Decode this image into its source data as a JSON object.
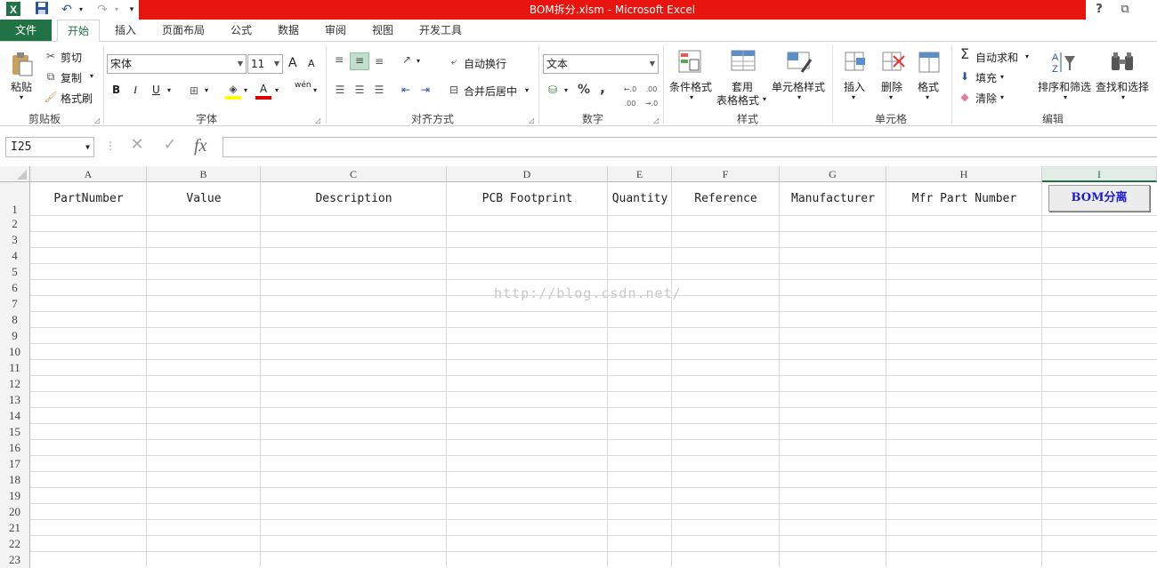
{
  "window": {
    "title": "BOM拆分.xlsm - Microsoft Excel",
    "help": "?",
    "restore": "⧉"
  },
  "tabs": [
    "文件",
    "开始",
    "插入",
    "页面布局",
    "公式",
    "数据",
    "审阅",
    "视图",
    "开发工具"
  ],
  "ribbon": {
    "clipboard": {
      "paste": "粘贴",
      "cut": "剪切",
      "copy": "复制",
      "format_painter": "格式刷",
      "label": "剪贴板"
    },
    "font": {
      "name": "宋体",
      "size": "11",
      "label": "字体",
      "bold": "B",
      "italic": "I",
      "underline": "U",
      "grow": "A",
      "shrink": "A",
      "wen": "wén"
    },
    "alignment": {
      "wrap": "自动换行",
      "merge": "合并后居中",
      "label": "对齐方式"
    },
    "number": {
      "format": "文本",
      "label": "数字",
      "percent": "%",
      "comma": ","
    },
    "styles": {
      "conditional": "条件格式",
      "table_l1": "套用",
      "table_l2": "表格格式",
      "cell_styles": "单元格样式",
      "label": "样式"
    },
    "cells": {
      "insert": "插入",
      "delete": "删除",
      "format": "格式",
      "label": "单元格"
    },
    "editing": {
      "autosum": "自动求和",
      "fill": "填充",
      "clear": "清除",
      "sort": "排序和筛选",
      "find": "查找和选择",
      "label": "编辑"
    }
  },
  "formula_bar": {
    "name_box": "I25",
    "fx": "fx",
    "value": ""
  },
  "sheet": {
    "columns": [
      "A",
      "B",
      "C",
      "D",
      "E",
      "F",
      "G",
      "H",
      "I"
    ],
    "header_row": [
      "PartNumber",
      "Value",
      "Description",
      "PCB Footprint",
      "Quantity",
      "Reference",
      "Manufacturer",
      "Mfr Part Number"
    ],
    "rows": [
      "1",
      "2",
      "3",
      "4",
      "5",
      "6",
      "7",
      "8",
      "9",
      "10",
      "11",
      "12",
      "13",
      "14",
      "15",
      "16",
      "17",
      "18",
      "19",
      "20",
      "21",
      "22",
      "23"
    ],
    "button_label": "BOM分离",
    "watermark": "http://blog.csdn.net/"
  },
  "colors": {
    "excel_green": "#217346",
    "title_red": "#e8140f",
    "button_text": "#1d1dcc"
  }
}
